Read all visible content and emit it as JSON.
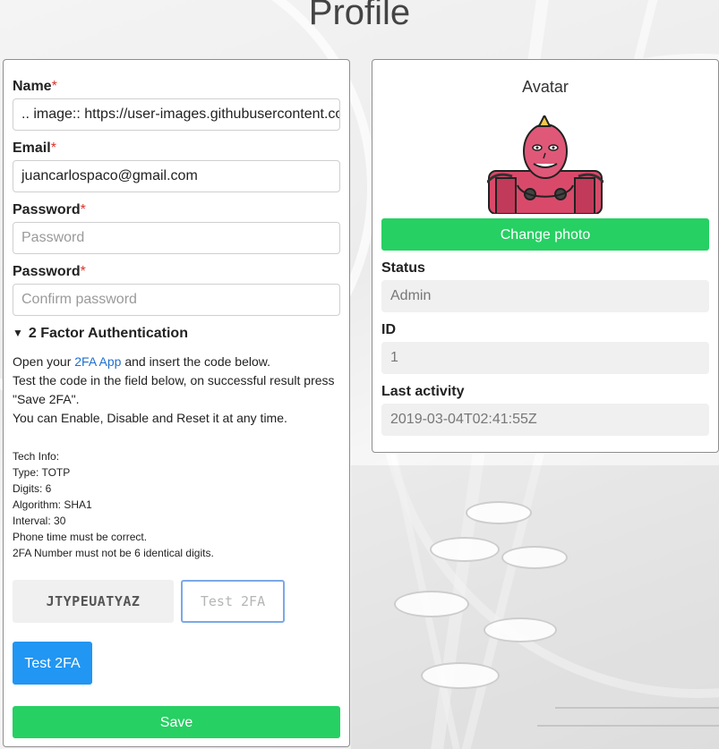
{
  "page": {
    "title": "Profile"
  },
  "form": {
    "name_label": "Name",
    "name_value": ".. image:: https://user-images.githubusercontent.com",
    "email_label": "Email",
    "email_value": "juancarlospaco@gmail.com",
    "password_label": "Password",
    "password_placeholder": "Password",
    "confirm_label": "Password",
    "confirm_placeholder": "Confirm password",
    "required_mark": "*"
  },
  "twofa": {
    "summary": "2 Factor Authentication",
    "desc_pre": "Open your ",
    "desc_link": "2FA App",
    "desc_post": " and insert the code below.",
    "desc_line2": "Test the code in the field below, on successful result press \"Save 2FA\".",
    "desc_line3": "You can Enable, Disable and Reset it at any time.",
    "tech": [
      "Tech Info:",
      "Type: TOTP",
      "Digits: 6",
      "Algorithm: SHA1",
      "Interval: 30",
      "Phone time must be correct.",
      "2FA Number must not be 6 identical digits."
    ],
    "secret_code": "JTYPEUATYAZ",
    "test_placeholder": "Test 2FA",
    "test_button": "Test 2FA"
  },
  "save_button": "Save",
  "avatar": {
    "title": "Avatar",
    "change_photo": "Change photo"
  },
  "info": {
    "status_label": "Status",
    "status_value": "Admin",
    "id_label": "ID",
    "id_value": "1",
    "last_activity_label": "Last activity",
    "last_activity_value": "2019-03-04T02:41:55Z"
  },
  "colors": {
    "accent_blue": "#2196f3",
    "accent_green": "#26d063",
    "required_red": "#d9342b",
    "link_blue": "#1e6fd0"
  },
  "icons": {
    "summary_toggle": "triangle-down-icon",
    "avatar": "robot-avatar-image"
  }
}
